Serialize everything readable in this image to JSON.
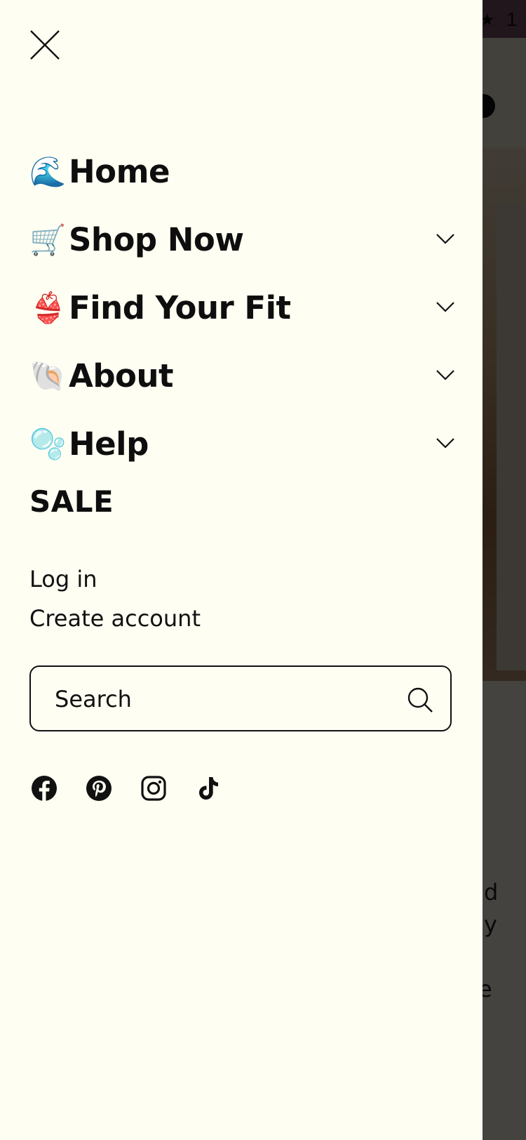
{
  "background": {
    "announcement_text": "1",
    "hero_text_lines": [
      "d",
      "y",
      "e"
    ]
  },
  "drawer": {
    "close_label": "Close menu",
    "nav": [
      {
        "emoji": "🌊",
        "label": "Home",
        "has_children": false
      },
      {
        "emoji": "🛒",
        "label": "Shop Now",
        "has_children": true
      },
      {
        "emoji": "👙",
        "label": "Find Your Fit",
        "has_children": true
      },
      {
        "emoji": "🐚",
        "label": "About",
        "has_children": true
      },
      {
        "emoji": "🫧",
        "label": "Help",
        "has_children": true
      }
    ],
    "sale_label": "SALE",
    "account": {
      "login_label": "Log in",
      "create_label": "Create account"
    },
    "search": {
      "placeholder": "Search"
    },
    "socials": [
      "facebook-icon",
      "pinterest-icon",
      "instagram-icon",
      "tiktok-icon"
    ]
  },
  "colors": {
    "drawer_bg": "#fffef2",
    "text": "#0e0e0e",
    "overlay": "rgba(0,0,0,0.72)"
  }
}
